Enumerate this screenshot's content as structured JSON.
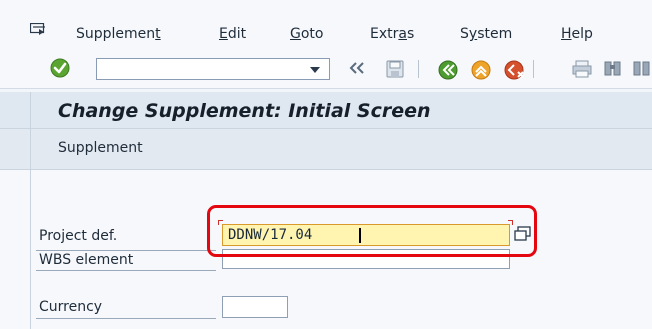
{
  "menu": {
    "items": [
      {
        "label": "Supplement",
        "mnemonic_index": 9
      },
      {
        "label": "Edit",
        "mnemonic_index": 0
      },
      {
        "label": "Goto",
        "mnemonic_index": 0
      },
      {
        "label": "Extras",
        "mnemonic_index": 4
      },
      {
        "label": "System",
        "mnemonic_index": 1
      },
      {
        "label": "Help",
        "mnemonic_index": 0
      }
    ]
  },
  "toolbar": {
    "command_field_value": "",
    "icons": [
      "enter-check-icon",
      "dropdown-arrow-icon",
      "double-chevron-left-icon",
      "save-icon",
      "back-icon",
      "exit-icon",
      "cancel-icon",
      "print-icon",
      "find-icon"
    ]
  },
  "title": "Change Supplement: Initial Screen",
  "app_toolbar": {
    "button": "Supplement"
  },
  "form": {
    "project_def_label": "Project def.",
    "project_def_value": "DDNW/17.04",
    "wbs_label": "WBS element",
    "wbs_value": "",
    "currency_label": "Currency",
    "currency_value": ""
  },
  "colors": {
    "highlight": "#e4070f",
    "active_field": "#fff4b0",
    "title_bg": "#dfe7f0"
  }
}
